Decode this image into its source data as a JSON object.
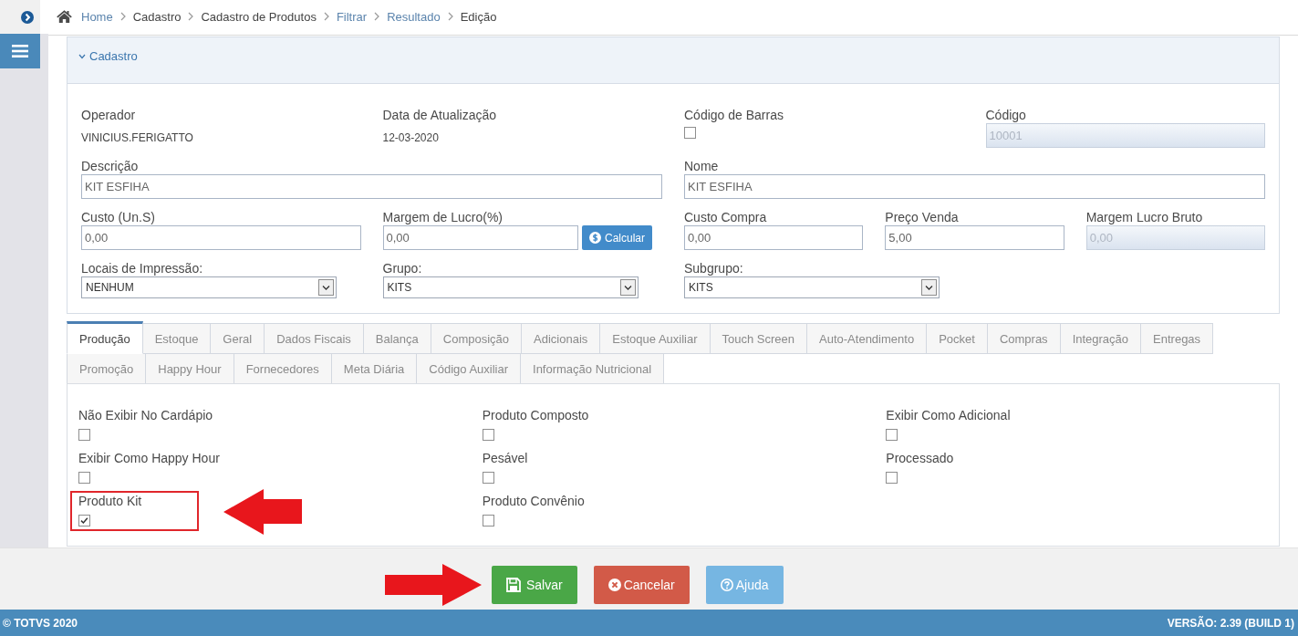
{
  "breadcrumb": [
    {
      "label": "Home",
      "link": true
    },
    {
      "label": "Cadastro",
      "link": false
    },
    {
      "label": "Cadastro de Produtos",
      "link": false
    },
    {
      "label": "Filtrar",
      "link": true
    },
    {
      "label": "Resultado",
      "link": true
    },
    {
      "label": "Edição",
      "link": false
    }
  ],
  "section": {
    "title": "Cadastro",
    "expanded": true,
    "rows": [
      {
        "left": [
          {
            "kind": "text",
            "label": "Operador",
            "value": "VINICIUS.FERIGATTO"
          },
          {
            "kind": "text",
            "label": "Data de Atualização",
            "value": "12-03-2020"
          }
        ],
        "right": [
          {
            "kind": "checkbox",
            "label": "Código de Barras",
            "checked": false
          },
          {
            "kind": "input",
            "label": "Código",
            "value": "10001",
            "disabled": true
          }
        ]
      },
      {
        "left": [
          {
            "kind": "input",
            "label": "Descrição",
            "value": "KIT ESFIHA",
            "disabled": false
          }
        ],
        "right": [
          {
            "kind": "input",
            "label": "Nome",
            "value": "KIT ESFIHA",
            "disabled": false
          }
        ]
      },
      {
        "left": [
          {
            "kind": "input",
            "label": "Custo (Un.S)",
            "value": "0,00",
            "disabled": false
          },
          {
            "kind": "input_action",
            "label": "Margem de Lucro(%)",
            "value": "0,00",
            "disabled": false,
            "button": "Calcular"
          }
        ],
        "right": [
          {
            "kind": "input",
            "label": "Custo Compra",
            "value": "0,00",
            "disabled": false
          },
          {
            "kind": "input",
            "label": "Preço Venda",
            "value": "5,00",
            "disabled": false
          },
          {
            "kind": "input",
            "label": "Margem Lucro Bruto",
            "value": "0,00",
            "disabled": true
          }
        ]
      },
      {
        "left": [
          {
            "kind": "select",
            "label": "Locais de Impressão:",
            "value": "NENHUM"
          },
          {
            "kind": "select",
            "label": "Grupo:",
            "value": "KITS"
          }
        ],
        "right": [
          {
            "kind": "select",
            "label": "Subgrupo:",
            "value": "KITS"
          }
        ]
      }
    ]
  },
  "tab_rows": [
    [
      {
        "label": "Produção",
        "selected": true
      },
      {
        "label": "Estoque",
        "selected": false
      },
      {
        "label": "Geral",
        "selected": false
      },
      {
        "label": "Dados Fiscais",
        "selected": false
      },
      {
        "label": "Balança",
        "selected": false
      },
      {
        "label": "Composição",
        "selected": false
      },
      {
        "label": "Adicionais",
        "selected": false
      },
      {
        "label": "Estoque Auxiliar",
        "selected": false
      },
      {
        "label": "Touch Screen",
        "selected": false
      },
      {
        "label": "Auto-Atendimento",
        "selected": false
      },
      {
        "label": "Pocket",
        "selected": false
      },
      {
        "label": "Compras",
        "selected": false
      },
      {
        "label": "Integração",
        "selected": false
      },
      {
        "label": "Entregas",
        "selected": false
      }
    ],
    [
      {
        "label": "Promoção",
        "selected": false
      },
      {
        "label": "Happy Hour",
        "selected": false
      },
      {
        "label": "Fornecedores",
        "selected": false
      },
      {
        "label": "Meta Diária",
        "selected": false
      },
      {
        "label": "Código Auxiliar",
        "selected": false
      },
      {
        "label": "Informação Nutricional",
        "selected": false
      }
    ]
  ],
  "tab_panel": {
    "options": [
      {
        "label": "Não Exibir No Cardápio",
        "checked": false,
        "highlighted": false
      },
      {
        "label": "Produto Composto",
        "checked": false,
        "highlighted": false
      },
      {
        "label": "Exibir Como Adicional",
        "checked": false,
        "highlighted": false
      },
      {
        "label": "Exibir Como Happy Hour",
        "checked": false,
        "highlighted": false
      },
      {
        "label": "Pesável",
        "checked": false,
        "highlighted": false
      },
      {
        "label": "Processado",
        "checked": false,
        "highlighted": false
      },
      {
        "label": "Produto Kit",
        "checked": true,
        "highlighted": true
      },
      {
        "label": "Produto Convênio",
        "checked": false,
        "highlighted": false
      }
    ]
  },
  "actions": [
    {
      "kind": "save",
      "label": "Salvar",
      "highlighted": true
    },
    {
      "kind": "cancel",
      "label": "Cancelar",
      "highlighted": false
    },
    {
      "kind": "help",
      "label": "Ajuda",
      "highlighted": false
    }
  ],
  "footer": {
    "copyright": "© TOTVS 2020",
    "version": "VERSÃO: 2.39 (BUILD 1)"
  }
}
